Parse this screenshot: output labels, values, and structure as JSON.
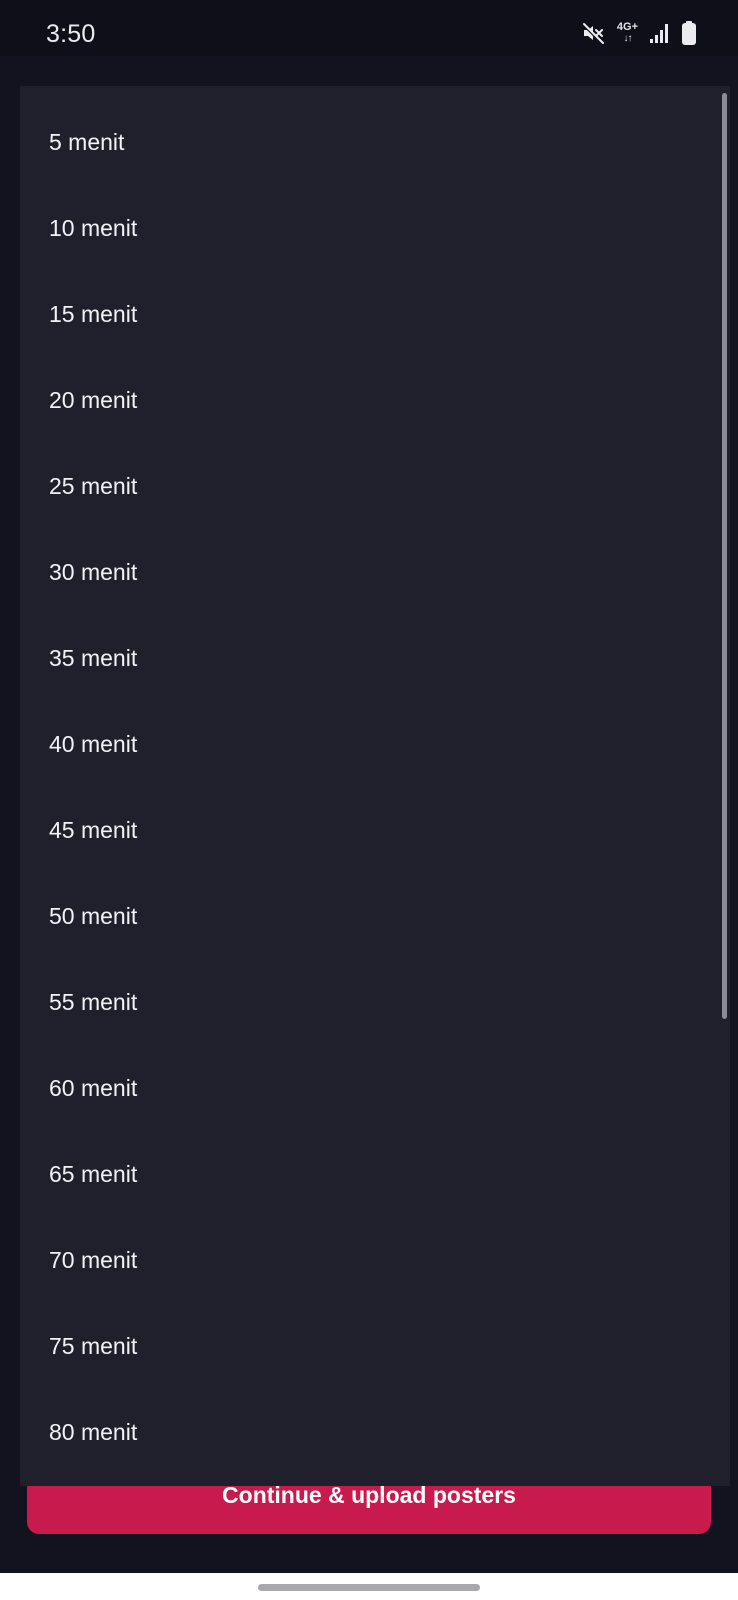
{
  "status_bar": {
    "time": "3:50",
    "network_type": "4G+",
    "network_arrows": "↓↑",
    "icons": [
      "mute-icon",
      "network-type-icon",
      "signal-icon",
      "battery-icon"
    ]
  },
  "dropdown": {
    "options": [
      "5 menit",
      "10 menit",
      "15 menit",
      "20 menit",
      "25 menit",
      "30 menit",
      "35 menit",
      "40 menit",
      "45 menit",
      "50 menit",
      "55 menit",
      "60 menit",
      "65 menit",
      "70 menit",
      "75 menit",
      "80 menit"
    ]
  },
  "footer": {
    "continue_label": "Continue & upload posters"
  },
  "colors": {
    "background": "#131320",
    "status_bar": "#0f0f19",
    "panel": "#201f2c",
    "accent": "#c91a4e",
    "text": "#f3f3f6",
    "scrollbar": "#8b8b95"
  }
}
